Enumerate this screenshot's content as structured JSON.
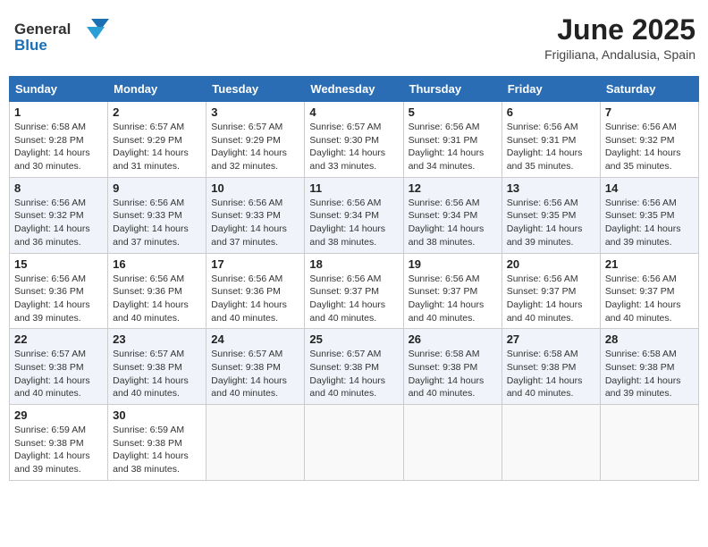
{
  "logo": {
    "text_general": "General",
    "text_blue": "Blue"
  },
  "title": {
    "month_year": "June 2025",
    "location": "Frigiliana, Andalusia, Spain"
  },
  "days_of_week": [
    "Sunday",
    "Monday",
    "Tuesday",
    "Wednesday",
    "Thursday",
    "Friday",
    "Saturday"
  ],
  "weeks": [
    [
      {
        "day": "1",
        "sunrise": "6:58 AM",
        "sunset": "9:28 PM",
        "daylight": "14 hours and 30 minutes."
      },
      {
        "day": "2",
        "sunrise": "6:57 AM",
        "sunset": "9:29 PM",
        "daylight": "14 hours and 31 minutes."
      },
      {
        "day": "3",
        "sunrise": "6:57 AM",
        "sunset": "9:29 PM",
        "daylight": "14 hours and 32 minutes."
      },
      {
        "day": "4",
        "sunrise": "6:57 AM",
        "sunset": "9:30 PM",
        "daylight": "14 hours and 33 minutes."
      },
      {
        "day": "5",
        "sunrise": "6:56 AM",
        "sunset": "9:31 PM",
        "daylight": "14 hours and 34 minutes."
      },
      {
        "day": "6",
        "sunrise": "6:56 AM",
        "sunset": "9:31 PM",
        "daylight": "14 hours and 35 minutes."
      },
      {
        "day": "7",
        "sunrise": "6:56 AM",
        "sunset": "9:32 PM",
        "daylight": "14 hours and 35 minutes."
      }
    ],
    [
      {
        "day": "8",
        "sunrise": "6:56 AM",
        "sunset": "9:32 PM",
        "daylight": "14 hours and 36 minutes."
      },
      {
        "day": "9",
        "sunrise": "6:56 AM",
        "sunset": "9:33 PM",
        "daylight": "14 hours and 37 minutes."
      },
      {
        "day": "10",
        "sunrise": "6:56 AM",
        "sunset": "9:33 PM",
        "daylight": "14 hours and 37 minutes."
      },
      {
        "day": "11",
        "sunrise": "6:56 AM",
        "sunset": "9:34 PM",
        "daylight": "14 hours and 38 minutes."
      },
      {
        "day": "12",
        "sunrise": "6:56 AM",
        "sunset": "9:34 PM",
        "daylight": "14 hours and 38 minutes."
      },
      {
        "day": "13",
        "sunrise": "6:56 AM",
        "sunset": "9:35 PM",
        "daylight": "14 hours and 39 minutes."
      },
      {
        "day": "14",
        "sunrise": "6:56 AM",
        "sunset": "9:35 PM",
        "daylight": "14 hours and 39 minutes."
      }
    ],
    [
      {
        "day": "15",
        "sunrise": "6:56 AM",
        "sunset": "9:36 PM",
        "daylight": "14 hours and 39 minutes."
      },
      {
        "day": "16",
        "sunrise": "6:56 AM",
        "sunset": "9:36 PM",
        "daylight": "14 hours and 40 minutes."
      },
      {
        "day": "17",
        "sunrise": "6:56 AM",
        "sunset": "9:36 PM",
        "daylight": "14 hours and 40 minutes."
      },
      {
        "day": "18",
        "sunrise": "6:56 AM",
        "sunset": "9:37 PM",
        "daylight": "14 hours and 40 minutes."
      },
      {
        "day": "19",
        "sunrise": "6:56 AM",
        "sunset": "9:37 PM",
        "daylight": "14 hours and 40 minutes."
      },
      {
        "day": "20",
        "sunrise": "6:56 AM",
        "sunset": "9:37 PM",
        "daylight": "14 hours and 40 minutes."
      },
      {
        "day": "21",
        "sunrise": "6:56 AM",
        "sunset": "9:37 PM",
        "daylight": "14 hours and 40 minutes."
      }
    ],
    [
      {
        "day": "22",
        "sunrise": "6:57 AM",
        "sunset": "9:38 PM",
        "daylight": "14 hours and 40 minutes."
      },
      {
        "day": "23",
        "sunrise": "6:57 AM",
        "sunset": "9:38 PM",
        "daylight": "14 hours and 40 minutes."
      },
      {
        "day": "24",
        "sunrise": "6:57 AM",
        "sunset": "9:38 PM",
        "daylight": "14 hours and 40 minutes."
      },
      {
        "day": "25",
        "sunrise": "6:57 AM",
        "sunset": "9:38 PM",
        "daylight": "14 hours and 40 minutes."
      },
      {
        "day": "26",
        "sunrise": "6:58 AM",
        "sunset": "9:38 PM",
        "daylight": "14 hours and 40 minutes."
      },
      {
        "day": "27",
        "sunrise": "6:58 AM",
        "sunset": "9:38 PM",
        "daylight": "14 hours and 40 minutes."
      },
      {
        "day": "28",
        "sunrise": "6:58 AM",
        "sunset": "9:38 PM",
        "daylight": "14 hours and 39 minutes."
      }
    ],
    [
      {
        "day": "29",
        "sunrise": "6:59 AM",
        "sunset": "9:38 PM",
        "daylight": "14 hours and 39 minutes."
      },
      {
        "day": "30",
        "sunrise": "6:59 AM",
        "sunset": "9:38 PM",
        "daylight": "14 hours and 38 minutes."
      },
      null,
      null,
      null,
      null,
      null
    ]
  ]
}
